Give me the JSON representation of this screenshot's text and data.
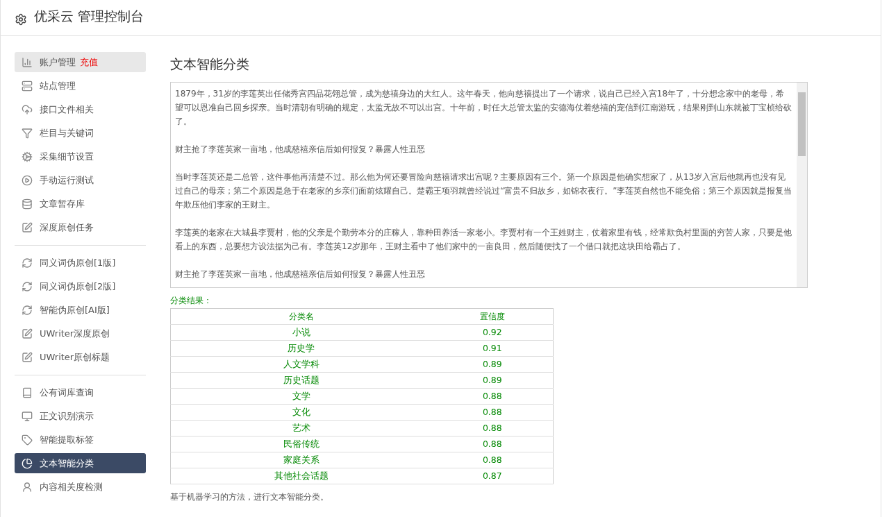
{
  "header": {
    "title": "优采云 管理控制台"
  },
  "sidebar": {
    "groups": [
      [
        {
          "label": "账户管理",
          "badge": "充值",
          "selected": false,
          "highlighted": true
        },
        {
          "label": "站点管理",
          "selected": false,
          "highlighted": false
        },
        {
          "label": "接口文件相关",
          "selected": false,
          "highlighted": false
        },
        {
          "label": "栏目与关键词",
          "selected": false,
          "highlighted": false
        },
        {
          "label": "采集细节设置",
          "selected": false,
          "highlighted": false
        },
        {
          "label": "手动运行测试",
          "selected": false,
          "highlighted": false
        },
        {
          "label": "文章暂存库",
          "selected": false,
          "highlighted": false
        },
        {
          "label": "深度原创任务",
          "selected": false,
          "highlighted": false
        }
      ],
      [
        {
          "label": "同义词伪原创[1版]",
          "selected": false,
          "highlighted": false
        },
        {
          "label": "同义词伪原创[2版]",
          "selected": false,
          "highlighted": false
        },
        {
          "label": "智能伪原创[AI版]",
          "selected": false,
          "highlighted": false
        },
        {
          "label": "UWriter深度原创",
          "selected": false,
          "highlighted": false
        },
        {
          "label": "UWriter原创标题",
          "selected": false,
          "highlighted": false
        }
      ],
      [
        {
          "label": "公有词库查询",
          "selected": false,
          "highlighted": false
        },
        {
          "label": "正文识别演示",
          "selected": false,
          "highlighted": false
        },
        {
          "label": "智能提取标签",
          "selected": false,
          "highlighted": false
        },
        {
          "label": "文本智能分类",
          "selected": true,
          "highlighted": false
        },
        {
          "label": "内容相关度检测",
          "selected": false,
          "highlighted": false
        }
      ]
    ]
  },
  "main": {
    "heading": "文本智能分类",
    "text_input": {
      "paragraphs": [
        "1879年，31岁的李莲英出任储秀宫四品花翎总管，成为慈禧身边的大红人。这年春天，他向慈禧提出了一个请求，说自己已经入宫18年了，十分想念家中的老母，希望可以恩准自己回乡探亲。当时清朝有明确的规定，太监无故不可以出宫。十年前，时任大总管太监的安德海仗着慈禧的宠信到江南游玩，结果刚到山东就被丁宝桢给砍了。",
        "财主抢了李莲英家一亩地，他成慈禧亲信后如何报复？暴露人性丑恶",
        "当时李莲英还是二总管，这件事他再清楚不过。那么他为何还要冒险向慈禧请求出宫呢？主要原因有三个。第一个原因是他确实想家了，从13岁入宫后他就再也没有见过自己的母亲；第二个原因是急于在老家的乡亲们面前炫耀自己。楚霸王项羽就曾经说过“富贵不归故乡，如锦衣夜行。”李莲英自然也不能免俗；第三个原因就是报复当年欺压他们李家的王财主。",
        "李莲英的老家在大城县李贾村，他的父亲是个勤劳本分的庄稼人，靠种田养活一家老小。李贾村有一个王姓财主，仗着家里有钱，经常欺负村里面的穷苦人家，只要是他看上的东西，总要想方设法据为己有。李莲英12岁那年，王财主看中了他们家中的一亩良田，然后随便找了一个借口就把这块田给霸占了。",
        "财主抢了李莲英家一亩地，他成慈禧亲信后如何报复？暴露人性丑恶"
      ]
    },
    "result_label": "分类结果：",
    "table": {
      "columns": [
        "分类名",
        "置信度"
      ],
      "rows": [
        [
          "小说",
          "0.92"
        ],
        [
          "历史学",
          "0.91"
        ],
        [
          "人文学科",
          "0.89"
        ],
        [
          "历史话题",
          "0.89"
        ],
        [
          "文学",
          "0.88"
        ],
        [
          "文化",
          "0.88"
        ],
        [
          "艺术",
          "0.88"
        ],
        [
          "民俗传统",
          "0.88"
        ],
        [
          "家庭关系",
          "0.88"
        ],
        [
          "其他社会话题",
          "0.87"
        ]
      ]
    },
    "note": "基于机器学习的方法，进行文本智能分类。"
  }
}
